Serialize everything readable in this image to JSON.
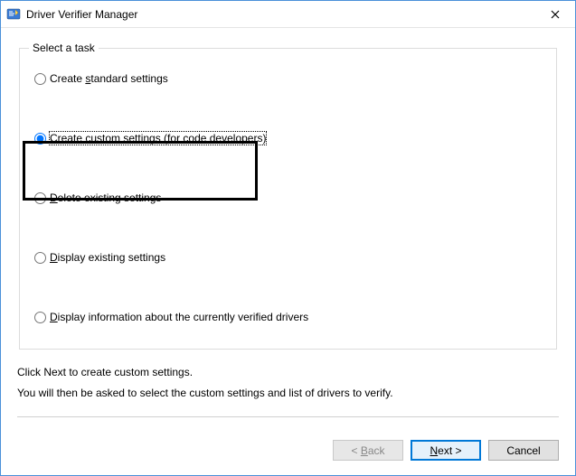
{
  "window": {
    "title": "Driver Verifier Manager"
  },
  "group": {
    "legend": "Select a task"
  },
  "options": {
    "standard": "Create standard settings",
    "custom": "Create custom settings (for code developers)",
    "delete": "Delete existing settings",
    "display": "Display existing settings",
    "info": "Display information about the currently verified drivers"
  },
  "hotkeys": {
    "standard": "s",
    "custom": "c",
    "delete": "D",
    "display": "D",
    "info": "D",
    "back": "B",
    "next": "N"
  },
  "instructions": {
    "line1": "Click Next to create custom settings.",
    "line2": "You will then be asked to select the custom settings and list of drivers to verify."
  },
  "buttons": {
    "back": "< Back",
    "next": "Next >",
    "cancel": "Cancel"
  },
  "state": {
    "selected_option": "custom",
    "back_enabled": false,
    "default_button": "next"
  }
}
